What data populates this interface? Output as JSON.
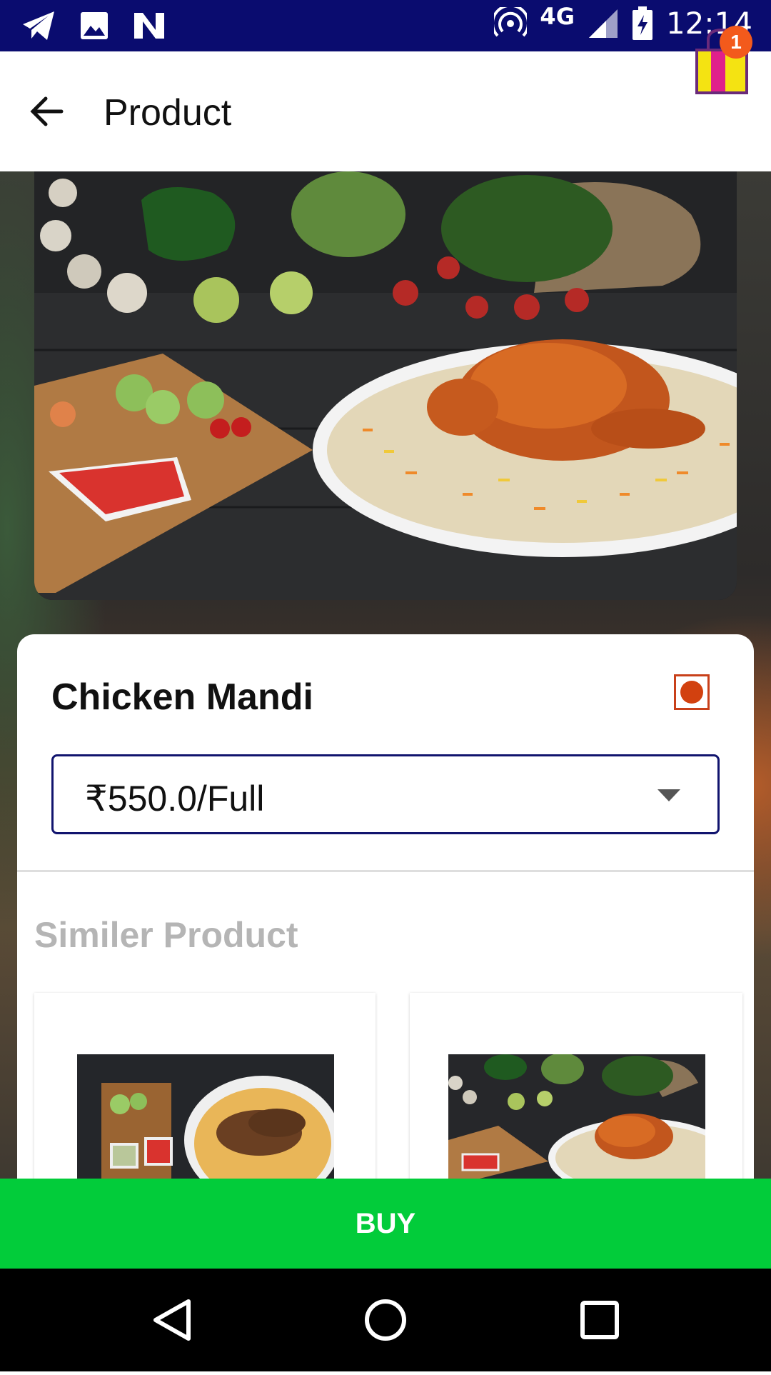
{
  "status_bar": {
    "network": "4G",
    "time": "12:14"
  },
  "app_bar": {
    "title": "Product",
    "cart_count": "1"
  },
  "product": {
    "name": "Chicken Mandi",
    "selected_price": "₹550.0/Full",
    "diet_indicator": "non-veg-icon"
  },
  "similar": {
    "title": "Similer Product"
  },
  "actions": {
    "buy_label": "BUY"
  },
  "colors": {
    "status_bar": "#0a0c6f",
    "buy_button": "#02cc3a",
    "badge": "#f35a1c",
    "select_border": "#11146e",
    "nonveg": "#d2410f"
  }
}
